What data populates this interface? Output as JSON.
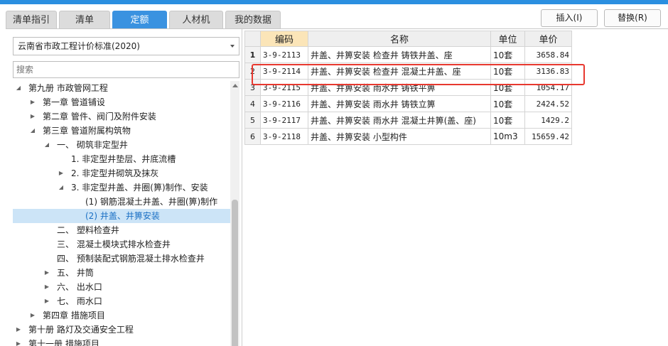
{
  "tabs": [
    "清单指引",
    "清单",
    "定额",
    "人材机",
    "我的数据"
  ],
  "buttons": {
    "insert": "插入(I)",
    "replace": "替换(R)"
  },
  "standard_select": "云南省市政工程计价标准(2020)",
  "search_placeholder": "搜索",
  "tree": [
    "第九册 市政管网工程",
    "第一章 管道铺设",
    "第二章 管件、阀门及附件安装",
    "第三章 管道附属构筑物",
    "一、 砌筑非定型井",
    "1. 非定型井垫层、井底流槽",
    "2. 非定型井砌筑及抹灰",
    "3. 非定型井盖、井圈(箅)制作、安装",
    "(1) 钢筋混凝土井盖、井圈(箅)制作",
    "(2) 井盖、井箅安装",
    "二、 塑料检查井",
    "三、 混凝土模块式排水检查井",
    "四、 预制装配式钢筋混凝土排水检查井",
    "五、 井筒",
    "六、 出水口",
    "七、 雨水口",
    "第四章 措施项目",
    "第十册 路灯及交通安全工程",
    "第十一册 措施项目"
  ],
  "table": {
    "headers": [
      "编码",
      "名称",
      "单位",
      "单价"
    ],
    "rows": [
      {
        "no": "1",
        "code": "3-9-2113",
        "name": "井盖、井箅安装 检查井 铸铁井盖、座",
        "unit": "10套",
        "price": "3658.84"
      },
      {
        "no": "2",
        "code": "3-9-2114",
        "name": "井盖、井箅安装 检查井 混凝土井盖、座",
        "unit": "10套",
        "price": "3136.83"
      },
      {
        "no": "3",
        "code": "3-9-2115",
        "name": "井盖、井箅安装 雨水井 铸铁平箅",
        "unit": "10套",
        "price": "1054.17"
      },
      {
        "no": "4",
        "code": "3-9-2116",
        "name": "井盖、井箅安装 雨水井 铸铁立箅",
        "unit": "10套",
        "price": "2424.52"
      },
      {
        "no": "5",
        "code": "3-9-2117",
        "name": "井盖、井箅安装 雨水井 混凝土井箅(盖、座)",
        "unit": "10套",
        "price": "1429.2"
      },
      {
        "no": "6",
        "code": "3-9-2118",
        "name": "井盖、井箅安装 小型构件",
        "unit": "10m3",
        "price": "15659.42"
      }
    ]
  }
}
